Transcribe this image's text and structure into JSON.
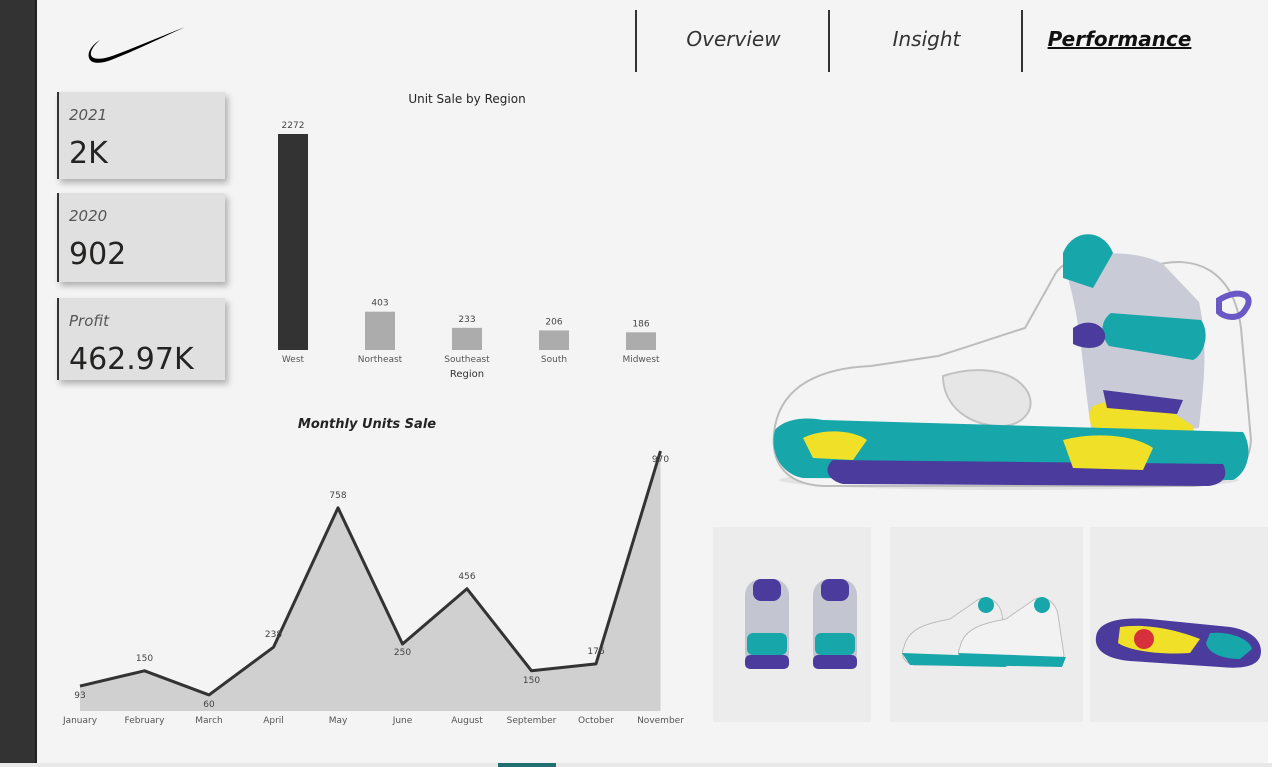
{
  "nav": {
    "items": [
      {
        "label": "Overview",
        "active": false
      },
      {
        "label": "Insight",
        "active": false
      },
      {
        "label": "Performance",
        "active": true
      }
    ]
  },
  "kpis": [
    {
      "label": "2021",
      "value": "2K"
    },
    {
      "label": "2020",
      "value": "902"
    },
    {
      "label": "Profit",
      "value": "462.97K"
    }
  ],
  "charts": {
    "region": {
      "title": "Unit Sale by Region"
    },
    "monthly": {
      "title": "Monthly Units Sale"
    }
  },
  "chart_data": [
    {
      "type": "bar",
      "title": "Unit Sale by Region",
      "xlabel": "Region",
      "ylabel": "",
      "categories": [
        "West",
        "Northeast",
        "Southeast",
        "South",
        "Midwest"
      ],
      "values": [
        2272,
        403,
        233,
        206,
        186
      ],
      "ylim": [
        0,
        2272
      ],
      "highlight_color": "#333333",
      "bar_color": "#acacac",
      "data_labels": true
    },
    {
      "type": "area",
      "title": "Monthly Units Sale",
      "xlabel": "",
      "ylabel": "",
      "categories": [
        "January",
        "February",
        "March",
        "April",
        "May",
        "June",
        "August",
        "September",
        "October",
        "November"
      ],
      "values": [
        93,
        150,
        60,
        238,
        758,
        250,
        456,
        150,
        176,
        970
      ],
      "ylim": [
        0,
        970
      ],
      "line_color": "#333333",
      "fill_color": "#d0d0d0",
      "data_labels": true
    }
  ]
}
